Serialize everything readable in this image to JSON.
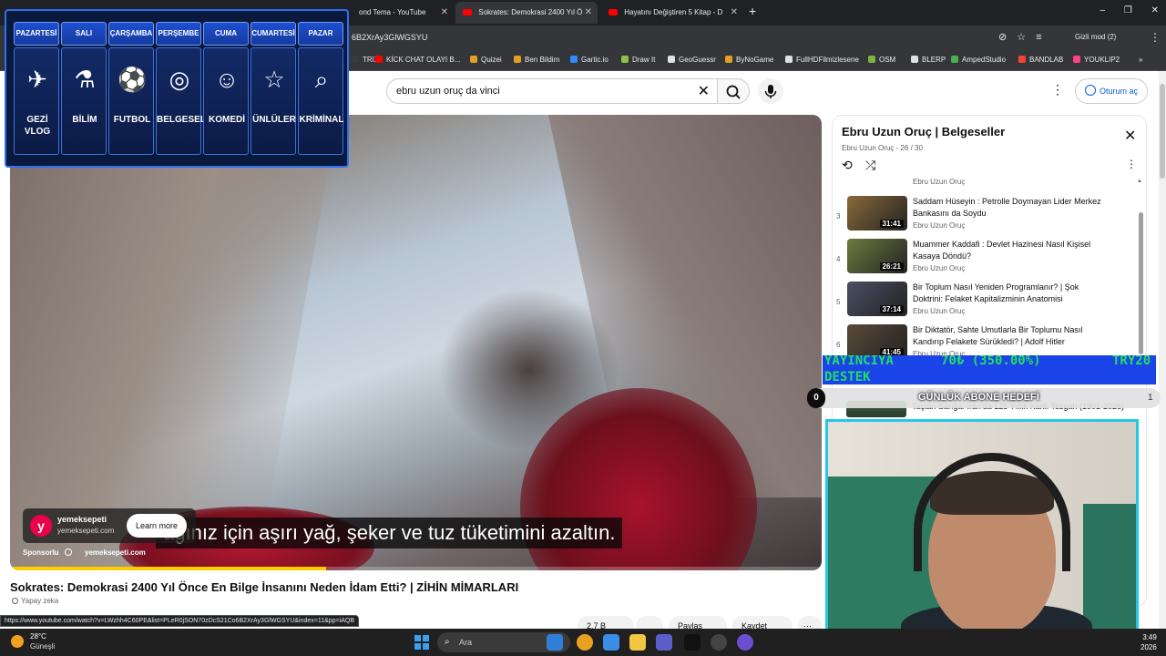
{
  "browser": {
    "tabs": [
      {
        "title": "ond Tema - YouTube",
        "active": false
      },
      {
        "title": "Sokrates: Demokrasi 2400 Yıl Ö",
        "active": true
      },
      {
        "title": "Hayatını Değiştiren 5 Kitap - D",
        "active": false
      }
    ],
    "new_tab": "+",
    "window_controls": "–  ❐  ✕",
    "url": "6B2XrAy3GlWGSYU",
    "incognito_label": "Gizli mod (2)",
    "bookmarks": [
      {
        "label": "TRIX",
        "color": "#3a3a3a"
      },
      {
        "label": "KİCK CHAT OLAYI B...",
        "color": "#ff0000"
      },
      {
        "label": "Quizei",
        "color": "#e0a020"
      },
      {
        "label": "Ben Bildim",
        "color": "#e0a020"
      },
      {
        "label": "Gartic.io",
        "color": "#2b8cff"
      },
      {
        "label": "Draw It",
        "color": "#8bc34a"
      },
      {
        "label": "GeoGuessr",
        "color": "#e0e0e0"
      },
      {
        "label": "ByNoGame",
        "color": "#e0a020"
      },
      {
        "label": "FullHDFilmizlesene",
        "color": "#e0e0e0"
      },
      {
        "label": "OSM",
        "color": "#7cb342"
      },
      {
        "label": "BLERP",
        "color": "#e0e0e0"
      },
      {
        "label": "AmpedStudio",
        "color": "#4caf50"
      },
      {
        "label": "BANDLAB",
        "color": "#f44336"
      },
      {
        "label": "YOUKLIP2",
        "color": "#ff4081"
      }
    ],
    "bookmarks_more": "»"
  },
  "youtube": {
    "search_query": "ebru uzun oruç da vinci",
    "signin_label": "Oturum aç",
    "video": {
      "subtitle": "ağınız için aşırı yağ, şeker ve tuz tüketimini azaltın.",
      "ad": {
        "name": "yemeksepeti",
        "domain": "yemeksepeti.com",
        "logo": "y",
        "cta": "Learn more",
        "sponsor_label": "Sponsorlu",
        "sponsor_domain": "yemeksepeti.com"
      },
      "ad_progress": 0.39,
      "title": "Sokrates: Demokrasi 2400 Yıl Önce En Bilge İnsanını Neden İdam Etti? | ZİHİN MİMARLARI",
      "ai_tag": "Yapay zeka",
      "actions": [
        "2,7 B",
        "",
        "Paylaş",
        "Kaydet",
        "⋯"
      ]
    },
    "playlist": {
      "title": "Ebru Uzun Oruç | Belgeseller",
      "subtitle": "Ebru Uzun Oruç - 26 / 30",
      "top_partial_channel": "Ebru Uzun Oruç",
      "items": [
        {
          "num": "3",
          "title": "Saddam Hüseyin : Petrolle Doymayan Lider Merkez Bankasını da Soydu",
          "channel": "Ebru Uzun Oruç",
          "duration": "31:41",
          "thumb": "#8a6a3a"
        },
        {
          "num": "4",
          "title": "Muammer Kaddafi : Devlet Hazinesi Nasıl Kişisel Kasaya Döndü?",
          "channel": "Ebru Uzun Oruç",
          "duration": "26:21",
          "thumb": "#6e7a3e"
        },
        {
          "num": "5",
          "title": "Bir Toplum Nasıl Yeniden Programlanır? | Şok Doktrini: Felaket Kapitalizminin Anatomisi",
          "channel": "Ebru Uzun Oruç",
          "duration": "37:14",
          "thumb": "#4a4f63"
        },
        {
          "num": "6",
          "title": "Bir Diktatör, Sahte Umutlarla Bir Toplumu Nasıl Kandırıp Felakete Sürükledi? | Adolf Hitler",
          "channel": "Ebru Uzun Oruç",
          "duration": "41:45",
          "thumb": "#5a4a3a"
        }
      ],
      "peek_title": "Taçtan Sarığa: İran'da 125 Yıllık Kanlı Tezgah (1901-2026)"
    },
    "status_url": "https://www.youtube.com/watch?v=LWzhh4C60PE&list=PLeR0jSON70zDcS21Co6B2XrAy3GlWGSYU&index=11&pp=iAQB"
  },
  "overlay": {
    "schedule": [
      {
        "day": "PAZARTESİ",
        "category": "GEZİ VLOG",
        "icon": "globe-plane-icon",
        "glyph": "✈"
      },
      {
        "day": "SALI",
        "category": "BİLİM",
        "icon": "microscope-icon",
        "glyph": "⚗"
      },
      {
        "day": "ÇARŞAMBA",
        "category": "FUTBOL",
        "icon": "soccer-ball-icon",
        "glyph": "⚽"
      },
      {
        "day": "PERŞEMBE",
        "category": "BELGESEL",
        "icon": "globe-icon",
        "glyph": "◎"
      },
      {
        "day": "CUMA",
        "category": "KOMEDİ",
        "icon": "theater-masks-icon",
        "glyph": "☺"
      },
      {
        "day": "CUMARTESİ",
        "category": "ÜNLÜLER",
        "icon": "star-icon",
        "glyph": "☆"
      },
      {
        "day": "PAZAR",
        "category": "KRİMİNAL",
        "icon": "fingerprint-magnifier-icon",
        "glyph": "⌕"
      }
    ],
    "donation": {
      "label_line1": "YAYINCIYA",
      "label_line2": "DESTEK",
      "amount": "70₺ (350.00%)",
      "currency": "TRY20"
    },
    "sub_goal": {
      "label": "GÜNLÜK ABONE HEDEFİ",
      "current": "0",
      "target": "1"
    }
  },
  "taskbar": {
    "temperature": "28°C",
    "condition": "Güneşli",
    "search_placeholder": "Ara",
    "time": "3:49",
    "date": "2026"
  }
}
